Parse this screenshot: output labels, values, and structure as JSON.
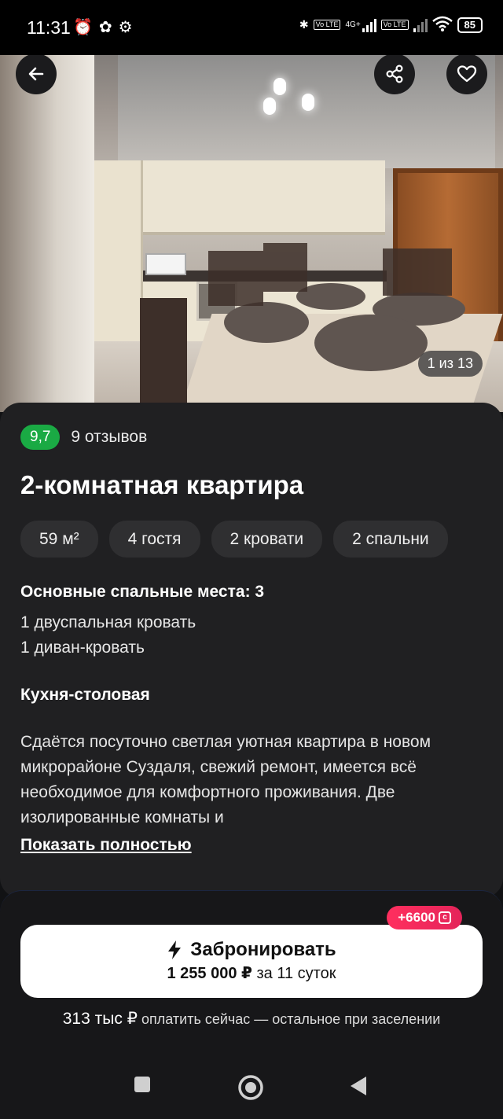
{
  "status_bar": {
    "time": "11:31",
    "battery": "85",
    "lte1": "Vo LTE",
    "net": "4G+",
    "lte2": "Vo LTE"
  },
  "gallery": {
    "counter": "1 из 13"
  },
  "rating": {
    "score": "9,7",
    "reviews": "9 отзывов"
  },
  "title": "2-комнатная квартира",
  "chips": [
    "59 м²",
    "4 гостя",
    "2 кровати",
    "2 спальни"
  ],
  "beds": {
    "heading": "Основные спальные места: 3",
    "items": [
      "1 двуспальная кровать",
      "1 диван-кровать"
    ]
  },
  "room_section": "Кухня-столовая",
  "description": "Сдаётся посуточно светлая уютная квартира в новом микрорайоне Суздаля, свежий ремонт, имеется всё необходимое для комфортного проживания. Две изолированные комнаты и",
  "show_more": "Показать полностью",
  "booking": {
    "bonus": "+6600",
    "button_label": "Забронировать",
    "price": "1 255 000 ₽",
    "period": "за 11 суток",
    "pay_now_amount": "313 тыс ₽",
    "pay_now_text": "оплатить сейчас — остальное при заселении"
  },
  "colors": {
    "rating_green": "#1aaa44",
    "bonus_red": "#ff2f5e",
    "card_bg": "#202022"
  }
}
